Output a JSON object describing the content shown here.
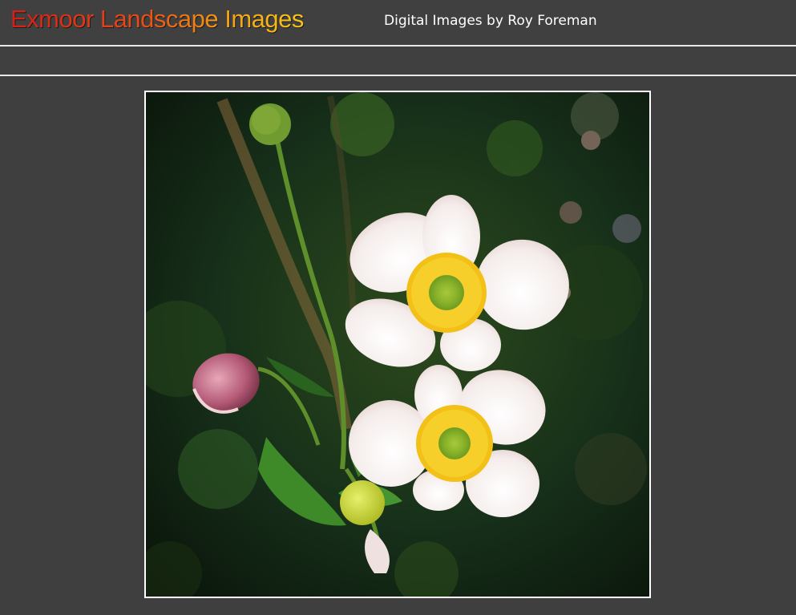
{
  "header": {
    "site_title": "Exmoor Landscape Images",
    "subtitle": "Digital Images by Roy Foreman"
  },
  "colors": {
    "page_background": "#3f3f3f",
    "divider": "#e9e9e9",
    "title_gradient_start": "#d31e16",
    "title_gradient_end": "#f7c51b",
    "frame_border": "#ffffff"
  },
  "main": {
    "photo": {
      "subject": "flower-photo"
    }
  }
}
